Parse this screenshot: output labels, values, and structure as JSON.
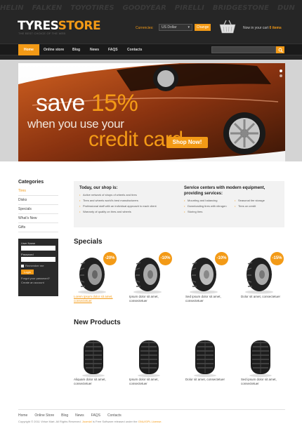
{
  "brands": [
    "HELIN",
    "FALKEN",
    "TOYOTIRES",
    "GOODYEAR",
    "PIRELLI",
    "BRIDGESTONE",
    "DUN"
  ],
  "logo": {
    "part1": "TYRES",
    "part2": "STORE",
    "tagline": "THE BEST CHOICE OF THE WEB"
  },
  "currency": {
    "label": "Currencies:",
    "selected": "US Dollar",
    "button": "Change"
  },
  "cart": {
    "text": "Now in your cart",
    "count": "0 items"
  },
  "nav": {
    "items": [
      "Home",
      "Online store",
      "Blog",
      "News",
      "FAQS",
      "Contacts"
    ]
  },
  "banner": {
    "save": "save",
    "percent": "15%",
    "line2": "when you use your",
    "line3": "credit card",
    "cta": "Shop Now!"
  },
  "sidebar": {
    "categories_title": "Categories",
    "categories": [
      "Tires",
      "Disks",
      "Specials",
      "What's New",
      "Gifts"
    ],
    "login": {
      "user_label": "User Name",
      "password_label": "Password",
      "remember": "Remember me",
      "button": "Login",
      "forgot": "Forgot your password?",
      "create": "Create an account"
    }
  },
  "info": {
    "left_title": "Today, our shop is:",
    "left_items": [
      "Active network of shops of wheels and tires",
      "Tires and wheels world's best manufacturers",
      "Professional staff with an individual approach to each client",
      "Warranty of quality on tires and wheels"
    ],
    "right_title": "Service centers with modern equipment, providing services:",
    "right_items_a": [
      "Mounting and balancing",
      "Downloading tires with nitrogen",
      "Storing tires"
    ],
    "right_items_b": [
      "Seasonal tire storage",
      "Tires on credit"
    ]
  },
  "specials": {
    "title": "Specials",
    "products": [
      {
        "badge": "-20%",
        "desc": "Lorem ipsum dolor sit amet, consectetuer"
      },
      {
        "badge": "-10%",
        "desc": "Ipsum dolor sit amet, consectetuer"
      },
      {
        "badge": "-10%",
        "desc": "Sed ipsum dolor sit amet, consectetuer"
      },
      {
        "badge": "-15%",
        "desc": "Dolor sit amet, consectetuer"
      }
    ]
  },
  "new_products": {
    "title": "New Products",
    "products": [
      {
        "desc": "Aliquam dolor sit amet, consectetuer"
      },
      {
        "desc": "Ipsum dolor sit amet, consectetuer"
      },
      {
        "desc": "Dolor sit amet, consectetuer"
      },
      {
        "desc": "Sed ipsum dolor sit amet, consectetuer"
      }
    ]
  },
  "footer": {
    "nav": [
      "Home",
      "Online Store",
      "Blog",
      "News",
      "FAQS",
      "Contacts"
    ],
    "copy_a": "Copyright © 2011 Virtue Mart. All Rights Reserved.",
    "copy_link": "Joomla!",
    "copy_b": "is Free Software released under the",
    "copy_license": "GNU/GPL License."
  },
  "colors": {
    "accent": "#f39a16",
    "header": "#262626",
    "nav": "#1a1a1a"
  },
  "icons": {
    "search": "search-icon",
    "cart": "basket-icon"
  }
}
